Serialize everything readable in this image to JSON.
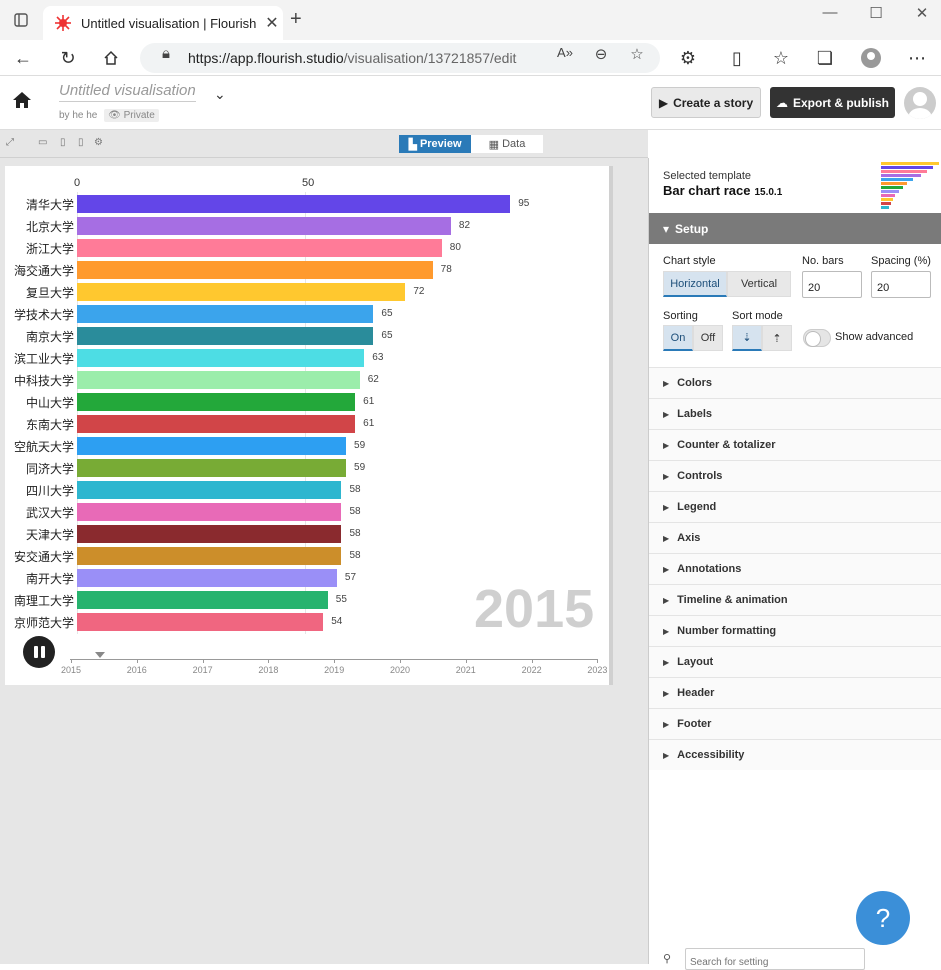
{
  "browser": {
    "tab_title": "Untitled visualisation | Flourish",
    "url_host": "https://app.flourish.studio",
    "url_path": "/visualisation/13721857/edit"
  },
  "header": {
    "vis_title": "Untitled visualisation",
    "byline": "by he he",
    "privacy": "Private",
    "story_label": "Create a story",
    "export_label": "Export & publish"
  },
  "toolbar": {
    "preview_label": "Preview",
    "data_label": "Data"
  },
  "chart_data": {
    "type": "bar",
    "orientation": "horizontal",
    "title": "",
    "year": "2015",
    "axis_ticks": [
      "0",
      "50"
    ],
    "xlim": [
      0,
      95
    ],
    "categories": [
      "清华大学",
      "北京大学",
      "浙江大学",
      "海交通大学",
      "复旦大学",
      "学技术大学",
      "南京大学",
      "滨工业大学",
      "中科技大学",
      "中山大学",
      "东南大学",
      "空航天大学",
      "同济大学",
      "四川大学",
      "武汉大学",
      "天津大学",
      "安交通大学",
      "南开大学",
      "南理工大学",
      "京师范大学"
    ],
    "values": [
      95,
      82,
      80,
      78,
      72,
      65,
      65,
      63,
      62,
      61,
      61,
      59,
      59,
      58,
      58,
      58,
      58,
      57,
      55,
      54
    ],
    "colors": [
      "#6346e8",
      "#a66ee3",
      "#ff7b98",
      "#ff9a2e",
      "#ffc82f",
      "#3ba4ec",
      "#2a8c9b",
      "#4ddde4",
      "#9bedab",
      "#23a83a",
      "#d14548",
      "#2d9ff2",
      "#78ab35",
      "#2eb6cf",
      "#e86ab7",
      "#8a2a2e",
      "#cc8e2a",
      "#9a8ff7",
      "#27b36e",
      "#f06680"
    ],
    "timeline": [
      "2015",
      "2016",
      "2017",
      "2018",
      "2019",
      "2020",
      "2021",
      "2022",
      "2023"
    ]
  },
  "panel": {
    "selected_template_label": "Selected template",
    "template_name": "Bar chart race",
    "template_version": "15.0.1",
    "setup_label": "Setup",
    "chart_style_label": "Chart style",
    "style_horizontal": "Horizontal",
    "style_vertical": "Vertical",
    "no_bars_label": "No. bars",
    "no_bars_value": "20",
    "spacing_label": "Spacing (%)",
    "spacing_value": "20",
    "sorting_label": "Sorting",
    "sorting_on": "On",
    "sorting_off": "Off",
    "sort_mode_label": "Sort mode",
    "show_advanced": "Show advanced",
    "sections": [
      "Colors",
      "Labels",
      "Counter & totalizer",
      "Controls",
      "Legend",
      "Axis",
      "Annotations",
      "Timeline & animation",
      "Number formatting",
      "Layout",
      "Header",
      "Footer",
      "Accessibility"
    ],
    "search_placeholder": "Search for setting"
  },
  "help_label": "?"
}
